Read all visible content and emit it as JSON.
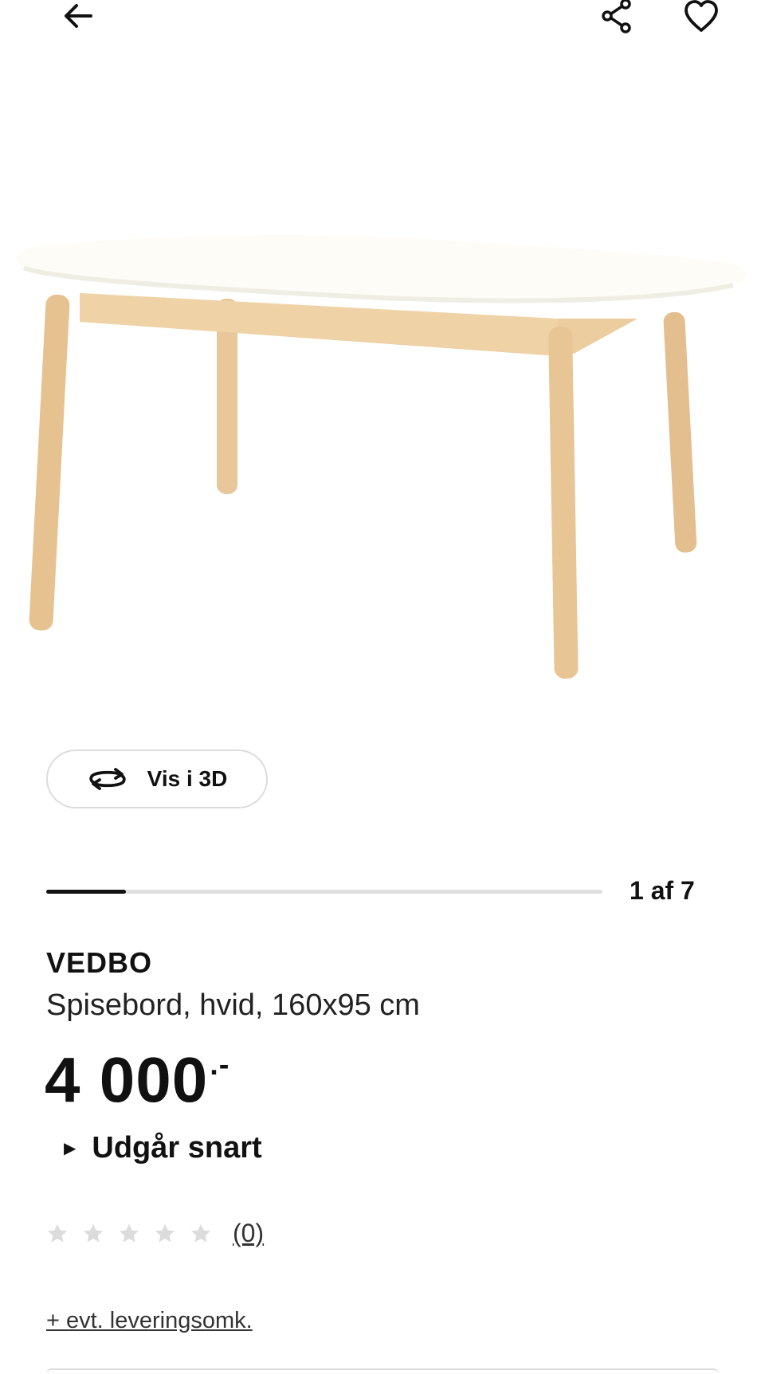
{
  "header": {
    "back_icon": "arrow-left-icon",
    "share_icon": "share-icon",
    "favorite_icon": "heart-icon"
  },
  "media": {
    "image_alt": "VEDBO",
    "view_3d_label": "Vis i 3D",
    "view_3d_icon": "rotate-3d-icon",
    "carousel": {
      "position_text": "1 af 7",
      "current": 1,
      "total": 7
    }
  },
  "product": {
    "name": "VEDBO",
    "description": "Spisebord, hvid, 160x95 cm",
    "price_main": "4 000",
    "price_suffix": ".-",
    "status_text": "Udgår snart",
    "rating": {
      "stars": 0,
      "max_stars": 5,
      "count_text": "(0)"
    },
    "delivery_text": "+ evt. leveringsomk."
  },
  "colors": {
    "text": "#111111",
    "muted": "#dfdfdf",
    "star_empty": "#dcdcdc"
  }
}
